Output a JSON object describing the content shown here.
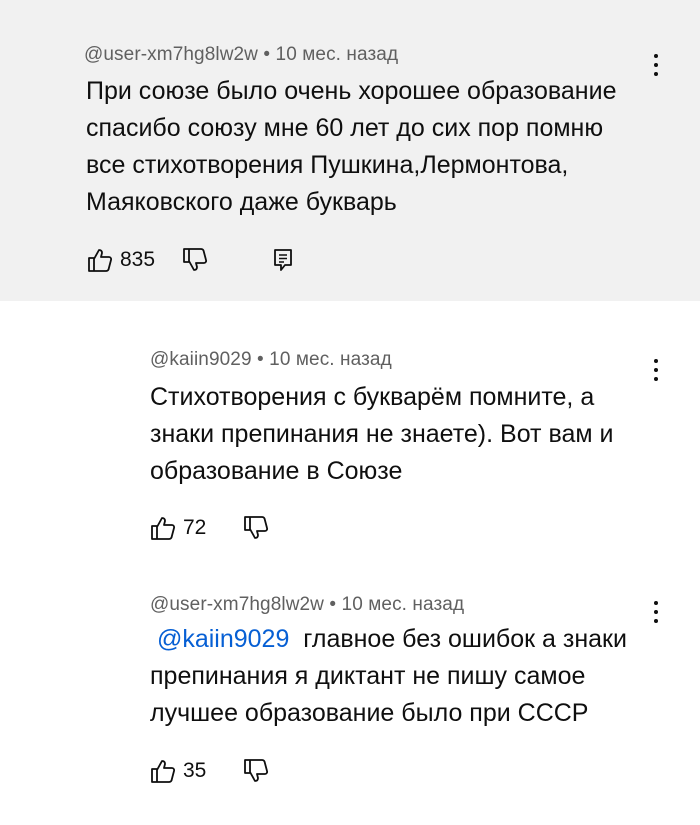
{
  "comments": [
    {
      "author": "@user-xm7hg8lw2w",
      "time": "10 мес. назад",
      "lines": [
        "При союзе было очень хорошее образование",
        "спасибо союзу мне 60 лет до сих пор помню",
        "все стихотворения Пушкина,Лермонтова,",
        "Маяковского даже букварь"
      ],
      "likes": "835",
      "icons": {
        "like": "thumbs-up-icon",
        "dislike": "thumbs-down-icon",
        "reply": "reply-comment-icon",
        "more": "more-vert-icon"
      }
    },
    {
      "author": "@kaiin9029",
      "time": "10 мес. назад",
      "lines": [
        "Стихотворения с букварём помните, а",
        "знаки препинания не знаете). Вот вам и",
        "образование в Союзе"
      ],
      "likes": "72"
    },
    {
      "author": "@user-xm7hg8lw2w",
      "time": "10 мес. назад",
      "mention": "@kaiin9029",
      "lines": [
        "главное без ошибок а знаки",
        "препинания я диктант не пишу самое",
        "лучшее образование было при СССР"
      ],
      "likes": "35"
    }
  ],
  "separator": " • ",
  "colors": {
    "highlight_bg": "#f1f1f1",
    "meta_text": "#606060",
    "mention": "#065fd4",
    "text": "#0f0f0f"
  }
}
